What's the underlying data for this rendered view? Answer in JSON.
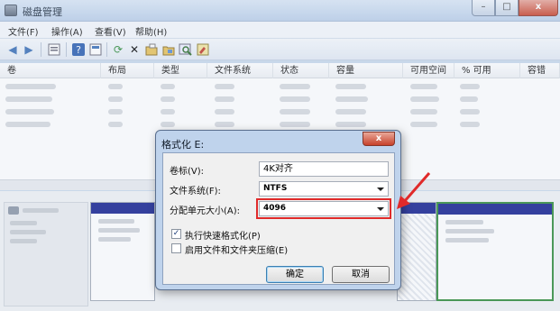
{
  "window": {
    "title": "磁盘管理",
    "controls": [
      "–",
      "□",
      "x"
    ]
  },
  "menu": [
    "文件(F)",
    "操作(A)",
    "查看(V)",
    "帮助(H)"
  ],
  "toolbar_icons": [
    "back-icon",
    "forward-icon",
    "list-icon",
    "help-icon",
    "properties-icon",
    "refresh-icon",
    "delete-icon",
    "open-icon",
    "explore-icon",
    "search-icon",
    "wizard-icon"
  ],
  "list": {
    "columns": [
      "卷",
      "布局",
      "类型",
      "文件系统",
      "状态",
      "容量",
      "可用空间",
      "% 可用",
      "容错"
    ]
  },
  "dialog": {
    "title": "格式化 E:",
    "close": "x",
    "volume_label": "卷标(V):",
    "volume_value": "4K对齐",
    "filesystem_label": "文件系统(F):",
    "filesystem_value": "NTFS",
    "alloc_label": "分配单元大小(A):",
    "alloc_value": "4096",
    "quick_format": {
      "label": "执行快速格式化(P)",
      "checked": true,
      "mark": "✓"
    },
    "compression": {
      "label": "启用文件和文件夹压缩(E)",
      "checked": false
    },
    "ok": "确定",
    "cancel": "取消"
  },
  "colors": {
    "partition_band": "#14208f",
    "highlight": "#e02a2a",
    "selected_partition": "#2f8b3a"
  }
}
